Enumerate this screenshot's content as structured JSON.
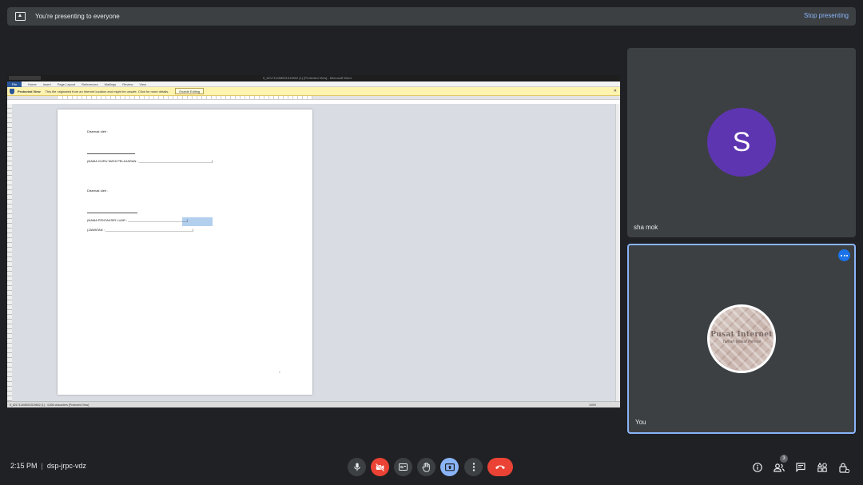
{
  "banner": {
    "message": "You're presenting to everyone",
    "stop_label": "Stop presenting"
  },
  "shared_screen": {
    "window_title": "5_621711408051519802 (1) [Protected View] - Microsoft Word",
    "ribbon_tabs": [
      "File",
      "Home",
      "Insert",
      "Page Layout",
      "References",
      "Mailings",
      "Review",
      "View"
    ],
    "protected_view": {
      "label": "Protected View",
      "message": "This file originated from an Internet location and might be unsafe. Click for more details.",
      "enable_button": "Enable Editing"
    },
    "doc": {
      "line1": "Disemak oleh :",
      "line2": "(NAMA GURU MATA PELAJARAN : _________________________________________)",
      "line3": "Disemak oleh :",
      "line4": "(NAMA PENTAKSIR LUAR : _________________________________)",
      "line5": "(JAWATAN : _________________________________________________)",
      "page_number": "5"
    },
    "status": "5_621711408051519802 (1) : 4,806 characters   [Protected View]",
    "zoom": "100%"
  },
  "participants": [
    {
      "name": "sha mok",
      "initial": "S",
      "color": "#5e35b1"
    },
    {
      "name": "You",
      "logo_line1": "Pusat Internet",
      "logo_line2": "Taman Wakaf Permai"
    }
  ],
  "bottom_bar": {
    "time": "2:15 PM",
    "meeting_code": "dsp-jrpc-vdz",
    "people_count": "3"
  },
  "icons": [
    "present-icon",
    "mic-icon",
    "camera-off-icon",
    "captions-icon",
    "hand-icon",
    "present-screen-icon",
    "more-vert-icon",
    "end-call-icon",
    "info-icon",
    "people-icon",
    "chat-icon",
    "activities-icon",
    "host-controls-icon"
  ]
}
